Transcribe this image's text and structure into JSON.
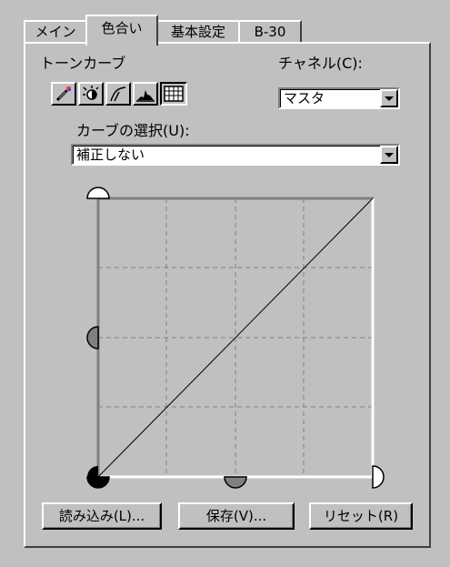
{
  "tabs": [
    {
      "label": "メイン"
    },
    {
      "label": "色合い"
    },
    {
      "label": "基本設定"
    },
    {
      "label": "B-30"
    }
  ],
  "active_tab": "色合い",
  "tone_curve": {
    "group_label": "トーンカーブ",
    "channel_label": "チャネル(C):",
    "channel_value": "マスタ",
    "curve_select_label": "カーブの選択(U):",
    "curve_select_value": "補正しない",
    "tools": [
      {
        "icon": "eyedropper-icon"
      },
      {
        "icon": "brightness-icon"
      },
      {
        "icon": "curve-icon"
      },
      {
        "icon": "histogram-icon"
      },
      {
        "icon": "grid-icon"
      }
    ],
    "pressed_tool": "grid-icon"
  },
  "buttons": {
    "load": "読み込み(L)...",
    "save": "保存(V)...",
    "reset": "リセット(R)"
  },
  "colors": {
    "face": "#c0c0c0",
    "grid_line": "#808080"
  }
}
